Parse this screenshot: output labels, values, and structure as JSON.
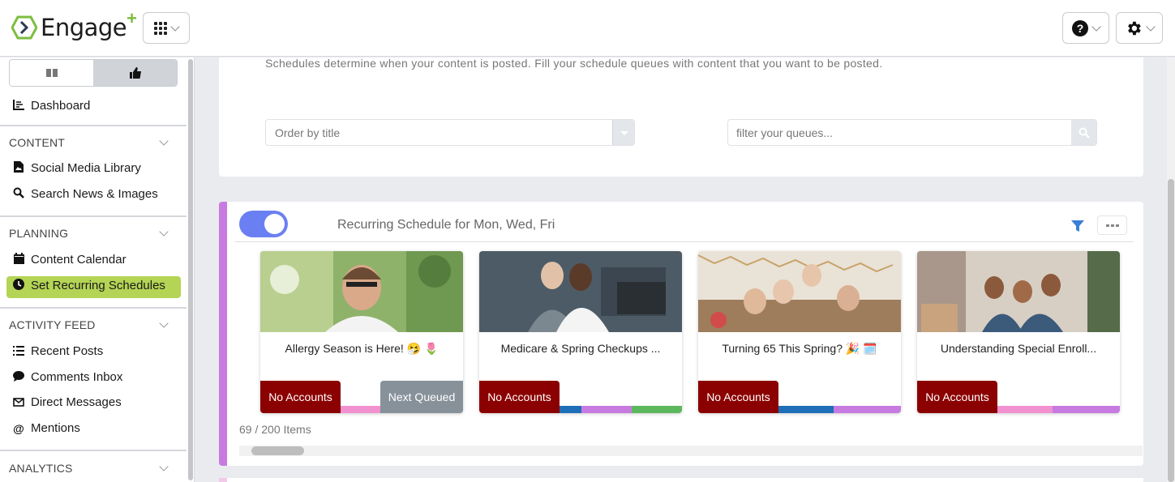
{
  "app": {
    "name": "Engage",
    "name_suffix": "+"
  },
  "colors": {
    "brand_green": "#7cbd3f",
    "active_item": "#b4d455",
    "toggle_on": "#6a80f2",
    "schedule_accent": "#c77be0",
    "no_accounts": "#8b0000"
  },
  "header": {
    "apps_icon": "grid-icon",
    "help_icon": "question-icon",
    "settings_icon": "gear-icon"
  },
  "sidebar": {
    "tabs": [
      {
        "icon": "book-icon"
      },
      {
        "icon": "thumbs-up-icon"
      }
    ],
    "dashboard": "Dashboard",
    "sections": [
      {
        "label": "CONTENT",
        "items": [
          "Social Media Library",
          "Search News & Images"
        ]
      },
      {
        "label": "PLANNING",
        "items": [
          "Content Calendar",
          "Set Recurring Schedules"
        ]
      },
      {
        "label": "ACTIVITY FEED",
        "items": [
          "Recent Posts",
          "Comments Inbox",
          "Direct Messages",
          "Mentions"
        ]
      },
      {
        "label": "ANALYTICS",
        "items": []
      }
    ],
    "active_item": "Set Recurring Schedules"
  },
  "schedules": {
    "description": "Schedules determine when your content is posted. Fill your schedule queues with content that you want to be posted.",
    "order_placeholder": "Order by title",
    "filter_placeholder": "filter your queues..."
  },
  "schedule": {
    "enabled": true,
    "title": "Recurring Schedule for Mon, Wed, Fri",
    "items_count": "69 / 200 Items",
    "cards": [
      {
        "title": "Allergy Season is Here! 🤧 🌷",
        "badge": "No Accounts",
        "queue_label": "Next Queued",
        "bars": [
          "#f291cf",
          "#8fa7a0"
        ]
      },
      {
        "title": "Medicare & Spring Checkups ...",
        "badge": "No Accounts",
        "bars": [
          "#1f6fb8",
          "#c77be0",
          "#5cb85c"
        ]
      },
      {
        "title": "Turning 65 This Spring? 🎉 🗓️",
        "badge": "No Accounts",
        "bars": [
          "#1f6fb8",
          "#c77be0"
        ]
      },
      {
        "title": "Understanding Special Enroll...",
        "badge": "No Accounts",
        "bars": [
          "#f291cf",
          "#c77be0"
        ]
      }
    ]
  }
}
